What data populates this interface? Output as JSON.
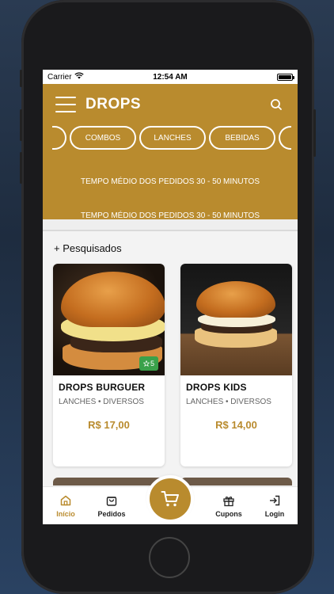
{
  "status": {
    "carrier": "Carrier",
    "time": "12:54 AM"
  },
  "header": {
    "title": "DROPS"
  },
  "categories": [
    "COMBOS",
    "LANCHES",
    "BEBIDAS"
  ],
  "banners": [
    "TEMPO MÉDIO DOS PEDIDOS 30 - 50 MINUTOS",
    "TEMPO MÉDIO DOS PEDIDOS 30 - 50 MINUTOS"
  ],
  "section": {
    "title": "+ Pesquisados"
  },
  "products": [
    {
      "name": "DROPS BURGUER",
      "category": "LANCHES • DIVERSOS",
      "price": "R$ 17,00",
      "rating": "5"
    },
    {
      "name": "DROPS KIDS",
      "category": "LANCHES • DIVERSOS",
      "price": "R$ 14,00"
    }
  ],
  "tabs": {
    "home": "Início",
    "orders": "Pedidos",
    "coupons": "Cupons",
    "login": "Login"
  },
  "colors": {
    "accent": "#b98b2e",
    "rating_badge": "#3aa14a"
  },
  "icons": [
    "menu-icon",
    "search-icon",
    "star-icon",
    "home-icon",
    "bag-icon",
    "cart-icon",
    "gift-icon",
    "login-icon",
    "wifi-icon",
    "battery-icon"
  ]
}
